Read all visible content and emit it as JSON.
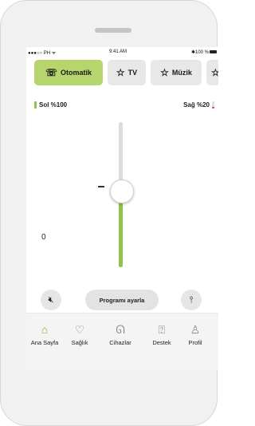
{
  "status_bar": {
    "carrier": "●●●○○ PH ᯤ",
    "time": "9:41 AM",
    "battery": "✱100 %"
  },
  "programs": [
    {
      "label": "Otomatik",
      "icon": "ear-wave-icon",
      "active": true
    },
    {
      "label": "TV",
      "icon": "star-icon",
      "active": false
    },
    {
      "label": "Müzik",
      "icon": "star-icon",
      "active": false
    }
  ],
  "balance": {
    "left_label": "Sol %100",
    "right_label": "Sağ %20",
    "left_level": 1.0,
    "right_level": 0.2,
    "left_color": "#8fc34a",
    "right_color": "#d9534f"
  },
  "volume": {
    "value": "0",
    "minus": "–"
  },
  "controls": {
    "mute_icon": "mute-icon",
    "adjust_label": "Programı ayarla",
    "tune_icon": "tune-icon"
  },
  "tabs": [
    {
      "label": "Ana Sayfa",
      "icon": "home-icon",
      "active": true
    },
    {
      "label": "Sağlık",
      "icon": "heart-icon",
      "active": false
    },
    {
      "label": "Cihazlar",
      "icon": "hearing-aid-icon",
      "active": false
    },
    {
      "label": "Destek",
      "icon": "help-icon",
      "active": false
    },
    {
      "label": "Profil",
      "icon": "profile-icon",
      "active": false
    }
  ],
  "colors": {
    "accent": "#79b940",
    "chip_active": "#b6d56c"
  }
}
